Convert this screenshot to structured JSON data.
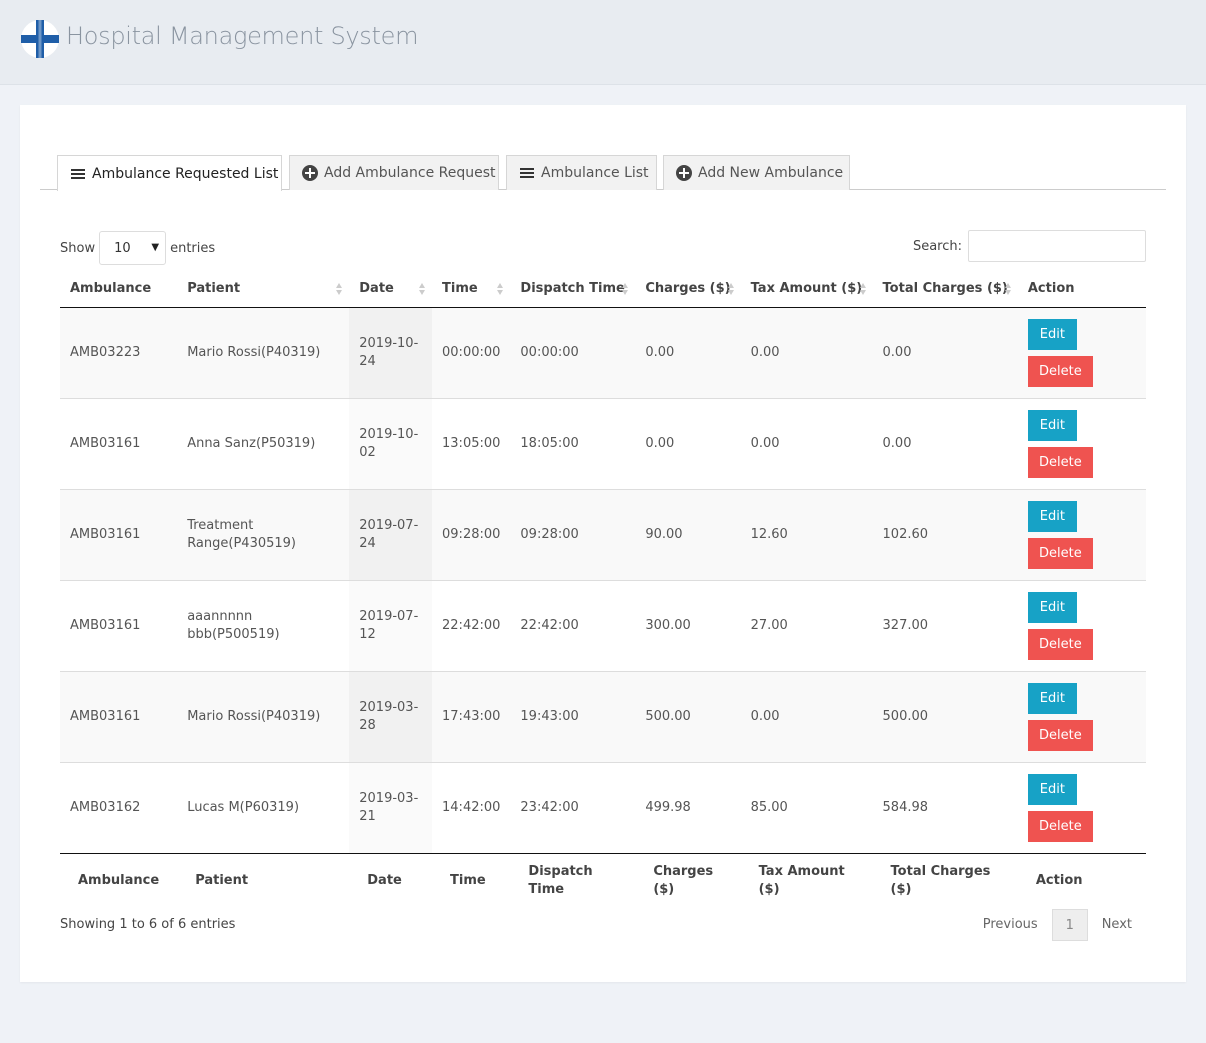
{
  "app": {
    "title": "Hospital Management System"
  },
  "tabs": [
    {
      "label": "Ambulance Requested List",
      "icon": "list-icon"
    },
    {
      "label": "Add Ambulance Request",
      "icon": "plus-circle-icon"
    },
    {
      "label": "Ambulance List",
      "icon": "list-icon"
    },
    {
      "label": "Add New Ambulance",
      "icon": "plus-circle-icon"
    }
  ],
  "controls": {
    "show_label": "Show",
    "entries_value": "10",
    "entries_label": "entries",
    "search_label": "Search:",
    "search_value": ""
  },
  "table": {
    "headers": [
      "Ambulance",
      "Patient",
      "Date",
      "Time",
      "Dispatch Time",
      "Charges ($)",
      "Tax Amount ($)",
      "Total Charges ($)",
      "Action"
    ],
    "footers": [
      "Ambulance",
      "Patient",
      "Date",
      "Time",
      "Dispatch Time",
      "Charges ($)",
      "Tax Amount ($)",
      "Total Charges ($)",
      "Action"
    ],
    "edit_label": "Edit",
    "delete_label": "Delete",
    "rows": [
      {
        "ambulance": "AMB03223",
        "patient": "Mario Rossi(P40319)",
        "date": "2019-10-24",
        "time": "00:00:00",
        "dispatch": "00:00:00",
        "charges": "0.00",
        "tax": "0.00",
        "total": "0.00"
      },
      {
        "ambulance": "AMB03161",
        "patient": "Anna Sanz(P50319)",
        "date": "2019-10-02",
        "time": "13:05:00",
        "dispatch": "18:05:00",
        "charges": "0.00",
        "tax": "0.00",
        "total": "0.00"
      },
      {
        "ambulance": "AMB03161",
        "patient": "Treatment Range(P430519)",
        "date": "2019-07-24",
        "time": "09:28:00",
        "dispatch": "09:28:00",
        "charges": "90.00",
        "tax": "12.60",
        "total": "102.60"
      },
      {
        "ambulance": "AMB03161",
        "patient": "aaannnnn bbb(P500519)",
        "date": "2019-07-12",
        "time": "22:42:00",
        "dispatch": "22:42:00",
        "charges": "300.00",
        "tax": "27.00",
        "total": "327.00"
      },
      {
        "ambulance": "AMB03161",
        "patient": "Mario Rossi(P40319)",
        "date": "2019-03-28",
        "time": "17:43:00",
        "dispatch": "19:43:00",
        "charges": "500.00",
        "tax": "0.00",
        "total": "500.00"
      },
      {
        "ambulance": "AMB03162",
        "patient": "Lucas M(P60319)",
        "date": "2019-03-21",
        "time": "14:42:00",
        "dispatch": "23:42:00",
        "charges": "499.98",
        "tax": "85.00",
        "total": "584.98"
      }
    ]
  },
  "footer": {
    "info": "Showing 1 to 6 of 6 entries",
    "previous": "Previous",
    "current_page": "1",
    "next": "Next"
  },
  "colors": {
    "edit": "#17a2c6",
    "delete": "#ef5350",
    "logo_blue": "#1f5ea8"
  }
}
